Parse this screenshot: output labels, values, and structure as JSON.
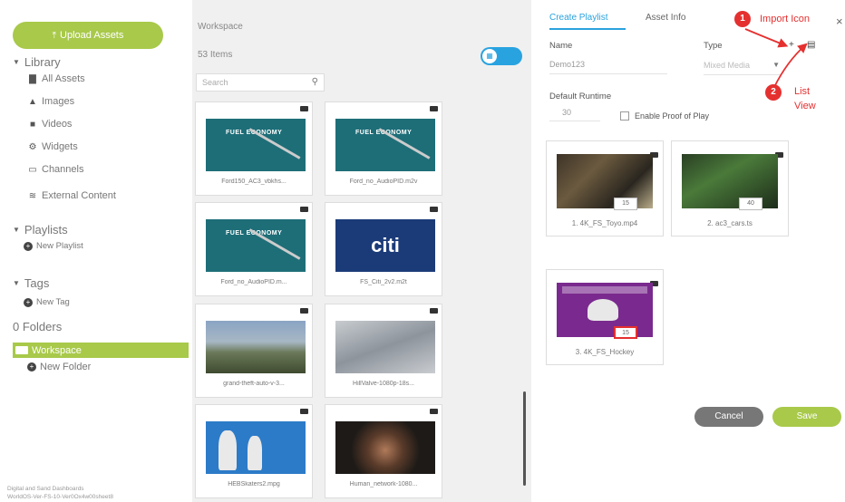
{
  "sidebar": {
    "upload_label": "Upload Assets",
    "library_label": "Library",
    "library_items": [
      "All Assets",
      "Images",
      "Videos",
      "Widgets",
      "Channels",
      "External Content"
    ],
    "playlists_label": "Playlists",
    "new_playlist": "New Playlist",
    "tags_label": "Tags",
    "new_tag": "New Tag",
    "folders_label": "0 Folders",
    "workspace_label": "Workspace",
    "new_folder": "New Folder",
    "footer_line1": "Digital and Sand Dashboards",
    "footer_line2": "WorldOS-Ver-FS-10-Ver0Ox4w00sheet8"
  },
  "workspace": {
    "title": "Workspace",
    "count": "53 Items",
    "search_placeholder": "Search",
    "tiles": [
      {
        "caption": "Ford150_AC3_vbkhs...",
        "thumb": "fuel"
      },
      {
        "caption": "Ford_no_AudioPID.m2v",
        "thumb": "fuel"
      },
      {
        "caption": "Ford_no_AudioPID.m...",
        "thumb": "fuel"
      },
      {
        "caption": "FS_Citi_2v2.m2t",
        "thumb": "citi"
      },
      {
        "caption": "grand-theft-auto-v-3...",
        "thumb": "city"
      },
      {
        "caption": "HillValve-1080p-18s...",
        "thumb": "snow"
      },
      {
        "caption": "HEBSkaters2.mpg",
        "thumb": "kids"
      },
      {
        "caption": "Human_network-1080...",
        "thumb": "boy"
      }
    ],
    "fuel_text": "FUEL ECONOMY"
  },
  "panel": {
    "tab_create": "Create Playlist",
    "tab_asset": "Asset Info",
    "name_label": "Name",
    "name_value": "Demo123",
    "type_label": "Type",
    "type_value": "Mixed Media",
    "runtime_label": "Default Runtime",
    "runtime_value": "30",
    "proof_label": "Enable Proof of Play",
    "items": [
      {
        "caption": "1. 4K_FS_Toyo.mp4",
        "duration": "15"
      },
      {
        "caption": "2. ac3_cars.ts",
        "duration": "40"
      },
      {
        "caption": "3. 4K_FS_Hockey",
        "duration": "15"
      }
    ],
    "cancel_label": "Cancel",
    "save_label": "Save",
    "citi_text": "citi"
  },
  "annotations": {
    "num1": "1",
    "text1": "Import Icon",
    "num2": "2",
    "text2a": "List",
    "text2b": "View"
  },
  "colors": {
    "accent_green": "#a8c94a",
    "accent_blue": "#2aa2dc",
    "annotation_red": "#e53030"
  }
}
